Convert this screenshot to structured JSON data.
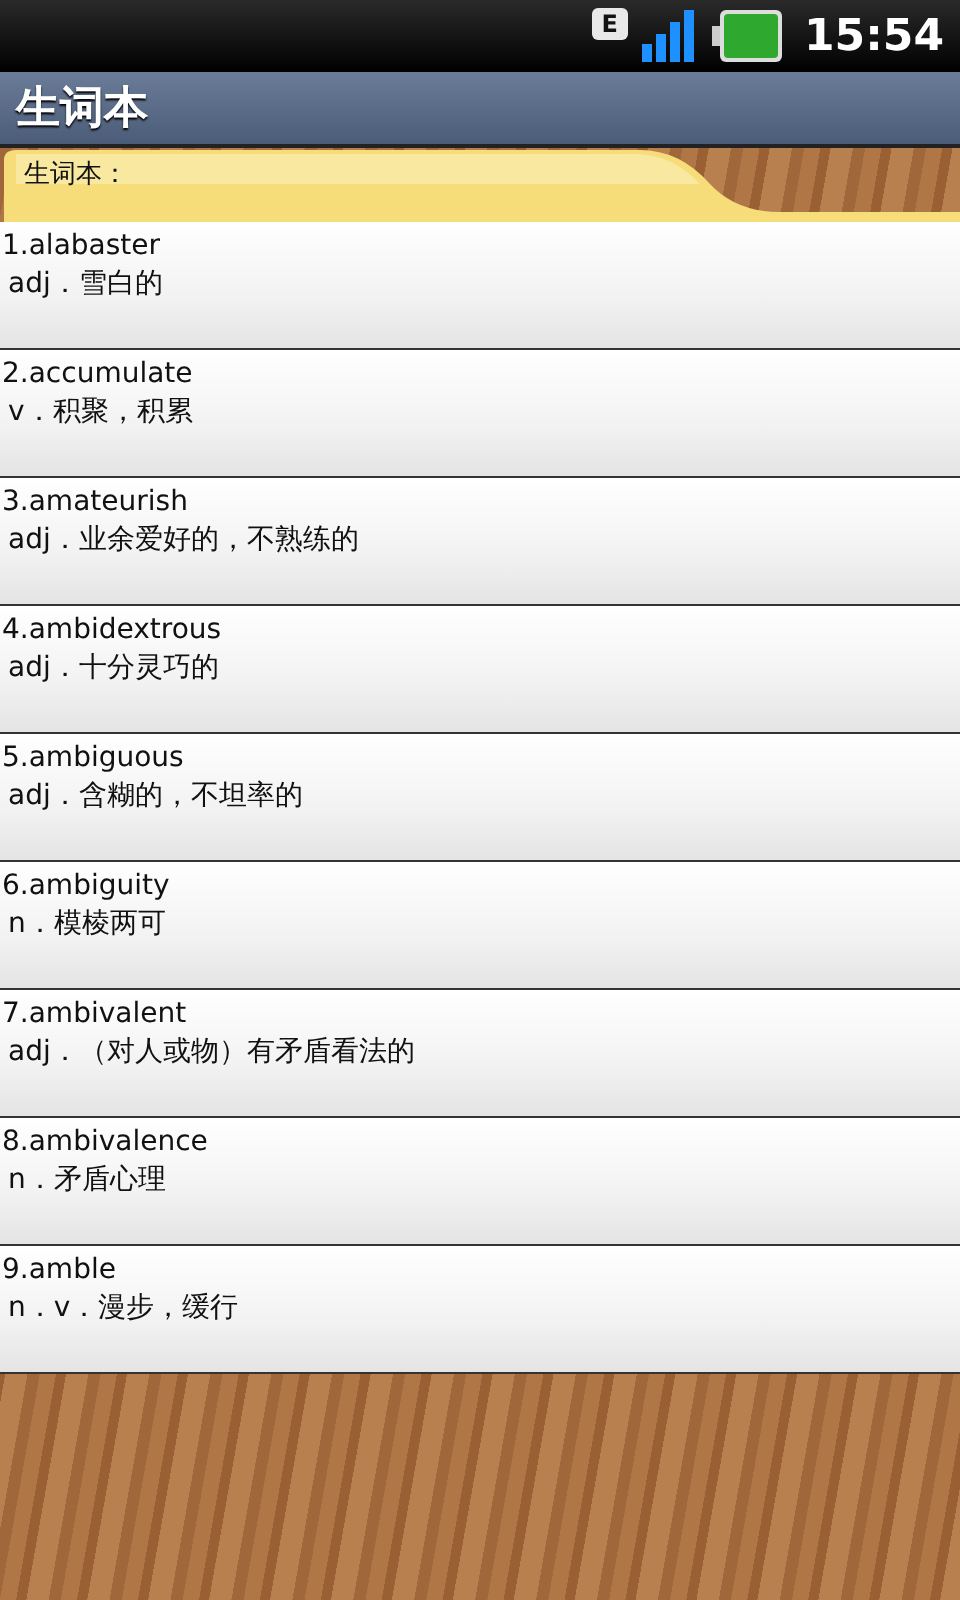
{
  "status_bar": {
    "network": "E",
    "time": "15:54"
  },
  "title": "生词本",
  "tab": {
    "label": "生词本："
  },
  "words": [
    {
      "word": "1.alabaster",
      "definition": "adj．雪白的"
    },
    {
      "word": "2.accumulate",
      "definition": "v．积聚，积累"
    },
    {
      "word": "3.amateurish",
      "definition": "adj．业余爱好的，不熟练的"
    },
    {
      "word": "4.ambidextrous",
      "definition": "adj．十分灵巧的"
    },
    {
      "word": "5.ambiguous",
      "definition": "adj．含糊的，不坦率的"
    },
    {
      "word": "6.ambiguity",
      "definition": "n．模棱两可"
    },
    {
      "word": "7.ambivalent",
      "definition": "adj．（对人或物）有矛盾看法的"
    },
    {
      "word": "8.ambivalence",
      "definition": "n．矛盾心理"
    },
    {
      "word": "9.amble",
      "definition": "n．v．漫步，缓行"
    }
  ]
}
